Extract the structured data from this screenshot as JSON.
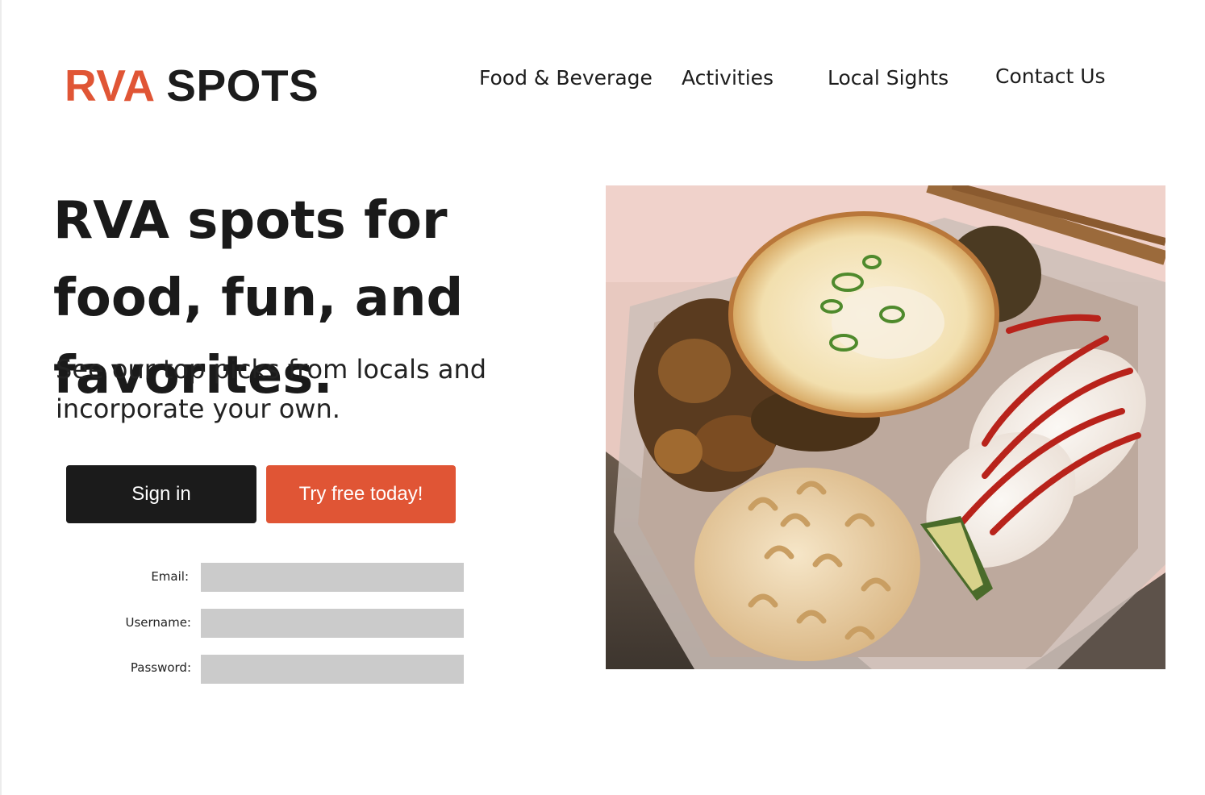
{
  "brand": {
    "part1": "RVA",
    "part2": "SPOTS",
    "accent_color": "#e05535",
    "text_color": "#1c1c1c"
  },
  "nav": [
    {
      "label": "Food & Beverage"
    },
    {
      "label": "Activities"
    },
    {
      "label": "Local Sights"
    },
    {
      "label": "Contact Us"
    }
  ],
  "hero": {
    "title": "RVA spots for food, fun, and favorites.",
    "subtitle": "See our top picks from locals and incorporate your own.",
    "image_icon": "food-plate-photo"
  },
  "buttons": {
    "signin_label": "Sign in",
    "signin_color": "#1b1b1b",
    "try_label": "Try free today!",
    "try_color": "#e05535"
  },
  "form": {
    "email_label": "Email:",
    "email_value": "",
    "username_label": "Username:",
    "username_value": "",
    "password_label": "Password:",
    "password_value": "",
    "field_color": "#cbcbcb"
  }
}
